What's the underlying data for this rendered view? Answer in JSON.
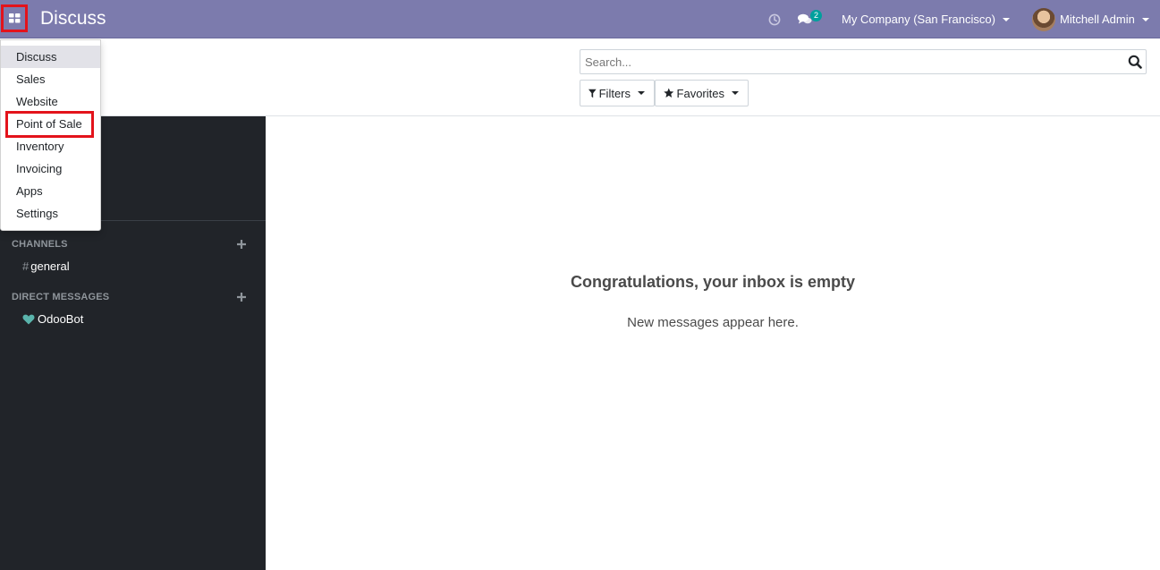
{
  "navbar": {
    "brand": "Discuss",
    "chat_badge": "2",
    "company": "My Company (San Francisco)",
    "user": "Mitchell Admin"
  },
  "app_menu": {
    "items": [
      {
        "label": "Discuss",
        "active": true
      },
      {
        "label": "Sales"
      },
      {
        "label": "Website"
      },
      {
        "label": "Point of Sale",
        "highlighted": true
      },
      {
        "label": "Inventory"
      },
      {
        "label": "Invoicing"
      },
      {
        "label": "Apps"
      },
      {
        "label": "Settings"
      }
    ]
  },
  "search": {
    "placeholder": "Search..."
  },
  "control": {
    "filters_label": "Filters",
    "favorites_label": "Favorites"
  },
  "sidebar": {
    "channels_header": "CHANNELS",
    "channels": [
      {
        "label": "general"
      }
    ],
    "dm_header": "DIRECT MESSAGES",
    "direct_messages": [
      {
        "label": "OdooBot"
      }
    ]
  },
  "main": {
    "empty_title": "Congratulations, your inbox is empty",
    "empty_subtitle": "New messages appear here."
  },
  "colors": {
    "navbar": "#7c7bad",
    "sidebar": "#212429",
    "badge": "#00a09d",
    "highlight": "#e3131b",
    "odoobot_heart": "#5ab4ac"
  }
}
